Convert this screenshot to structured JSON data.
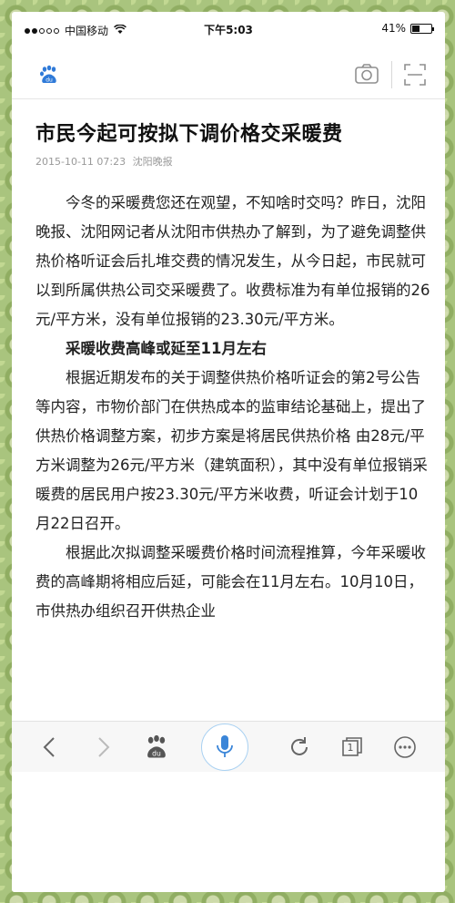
{
  "status_bar": {
    "carrier": "中国移动",
    "time": "下午5:03",
    "battery_percent": "41%",
    "battery_level": 0.41
  },
  "search_bar": {
    "logo_icon": "baidu-paw-icon",
    "camera_icon": "camera-icon",
    "scan_icon": "scan-icon"
  },
  "article": {
    "title": "市民今起可按拟下调价格交采暖费",
    "date": "2015-10-11 07:23",
    "source": "沈阳晚报",
    "paragraphs": [
      "今冬的采暖费您还在观望，不知啥时交吗？昨日，沈阳晚报、沈阳网记者从沈阳市供热办了解到，为了避免调整供热价格听证会后扎堆交费的情况发生，从今日起，市民就可以到所属供热公司交采暖费了。收费标准为有单位报销的26元/平方米，没有单位报销的23.30元/平方米。",
      "采暖收费高峰或延至11月左右",
      "根据近期发布的关于调整供热价格听证会的第2号公告等内容，市物价部门在供热成本的监审结论基础上，提出了供热价格调整方案，初步方案是将居民供热价格 由28元/平方米调整为26元/平方米（建筑面积），其中没有单位报销采暖费的居民用户按23.30元/平方米收费，听证会计划于10月22日召开。",
      "根据此次拟调整采暖费价格时间流程推算，今年采暖收费的高峰期将相应后延，可能会在11月左右。10月10日，市供热办组织召开供热企业"
    ]
  },
  "bottom_bar": {
    "back_icon": "back-arrow-icon",
    "forward_icon": "forward-arrow-icon",
    "home_icon": "baidu-paw-icon",
    "voice_icon": "microphone-icon",
    "refresh_icon": "refresh-icon",
    "tabs_count": "1",
    "menu_icon": "more-icon"
  },
  "colors": {
    "accent_blue": "#3a85d8",
    "mic_ring": "#a9d1f2",
    "background_green": "#a9c47e"
  }
}
